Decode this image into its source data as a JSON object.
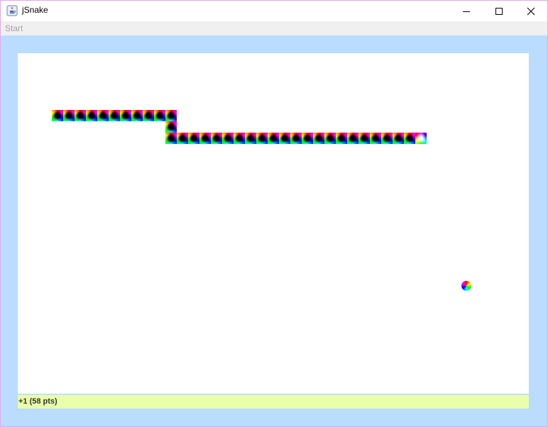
{
  "window": {
    "title": "jSnake",
    "icon": "java-coffee-cup-icon",
    "controls": [
      "minimize-icon",
      "maximize-icon",
      "close-icon"
    ]
  },
  "menu": {
    "items": [
      {
        "label": "Start",
        "enabled": false
      }
    ]
  },
  "game": {
    "grid_cell_size": 16,
    "snake": {
      "body": [
        [
          3,
          5
        ],
        [
          4,
          5
        ],
        [
          5,
          5
        ],
        [
          6,
          5
        ],
        [
          7,
          5
        ],
        [
          8,
          5
        ],
        [
          9,
          5
        ],
        [
          10,
          5
        ],
        [
          11,
          5
        ],
        [
          12,
          5
        ],
        [
          13,
          5
        ],
        [
          13,
          6
        ],
        [
          13,
          7
        ],
        [
          14,
          7
        ],
        [
          15,
          7
        ],
        [
          16,
          7
        ],
        [
          17,
          7
        ],
        [
          18,
          7
        ],
        [
          19,
          7
        ],
        [
          20,
          7
        ],
        [
          21,
          7
        ],
        [
          22,
          7
        ],
        [
          23,
          7
        ],
        [
          24,
          7
        ],
        [
          25,
          7
        ],
        [
          26,
          7
        ],
        [
          27,
          7
        ],
        [
          28,
          7
        ],
        [
          29,
          7
        ],
        [
          30,
          7
        ],
        [
          31,
          7
        ],
        [
          32,
          7
        ],
        [
          33,
          7
        ],
        [
          34,
          7
        ]
      ],
      "head": [
        35,
        7
      ]
    },
    "food": [
      39,
      20
    ]
  },
  "status": {
    "text": "+1 (58 pts)"
  },
  "colors": {
    "window_background": "#b9dcff",
    "board_background": "#ffffff",
    "status_background": "#eaffaa",
    "menu_disabled_text": "#a3a3a3"
  }
}
